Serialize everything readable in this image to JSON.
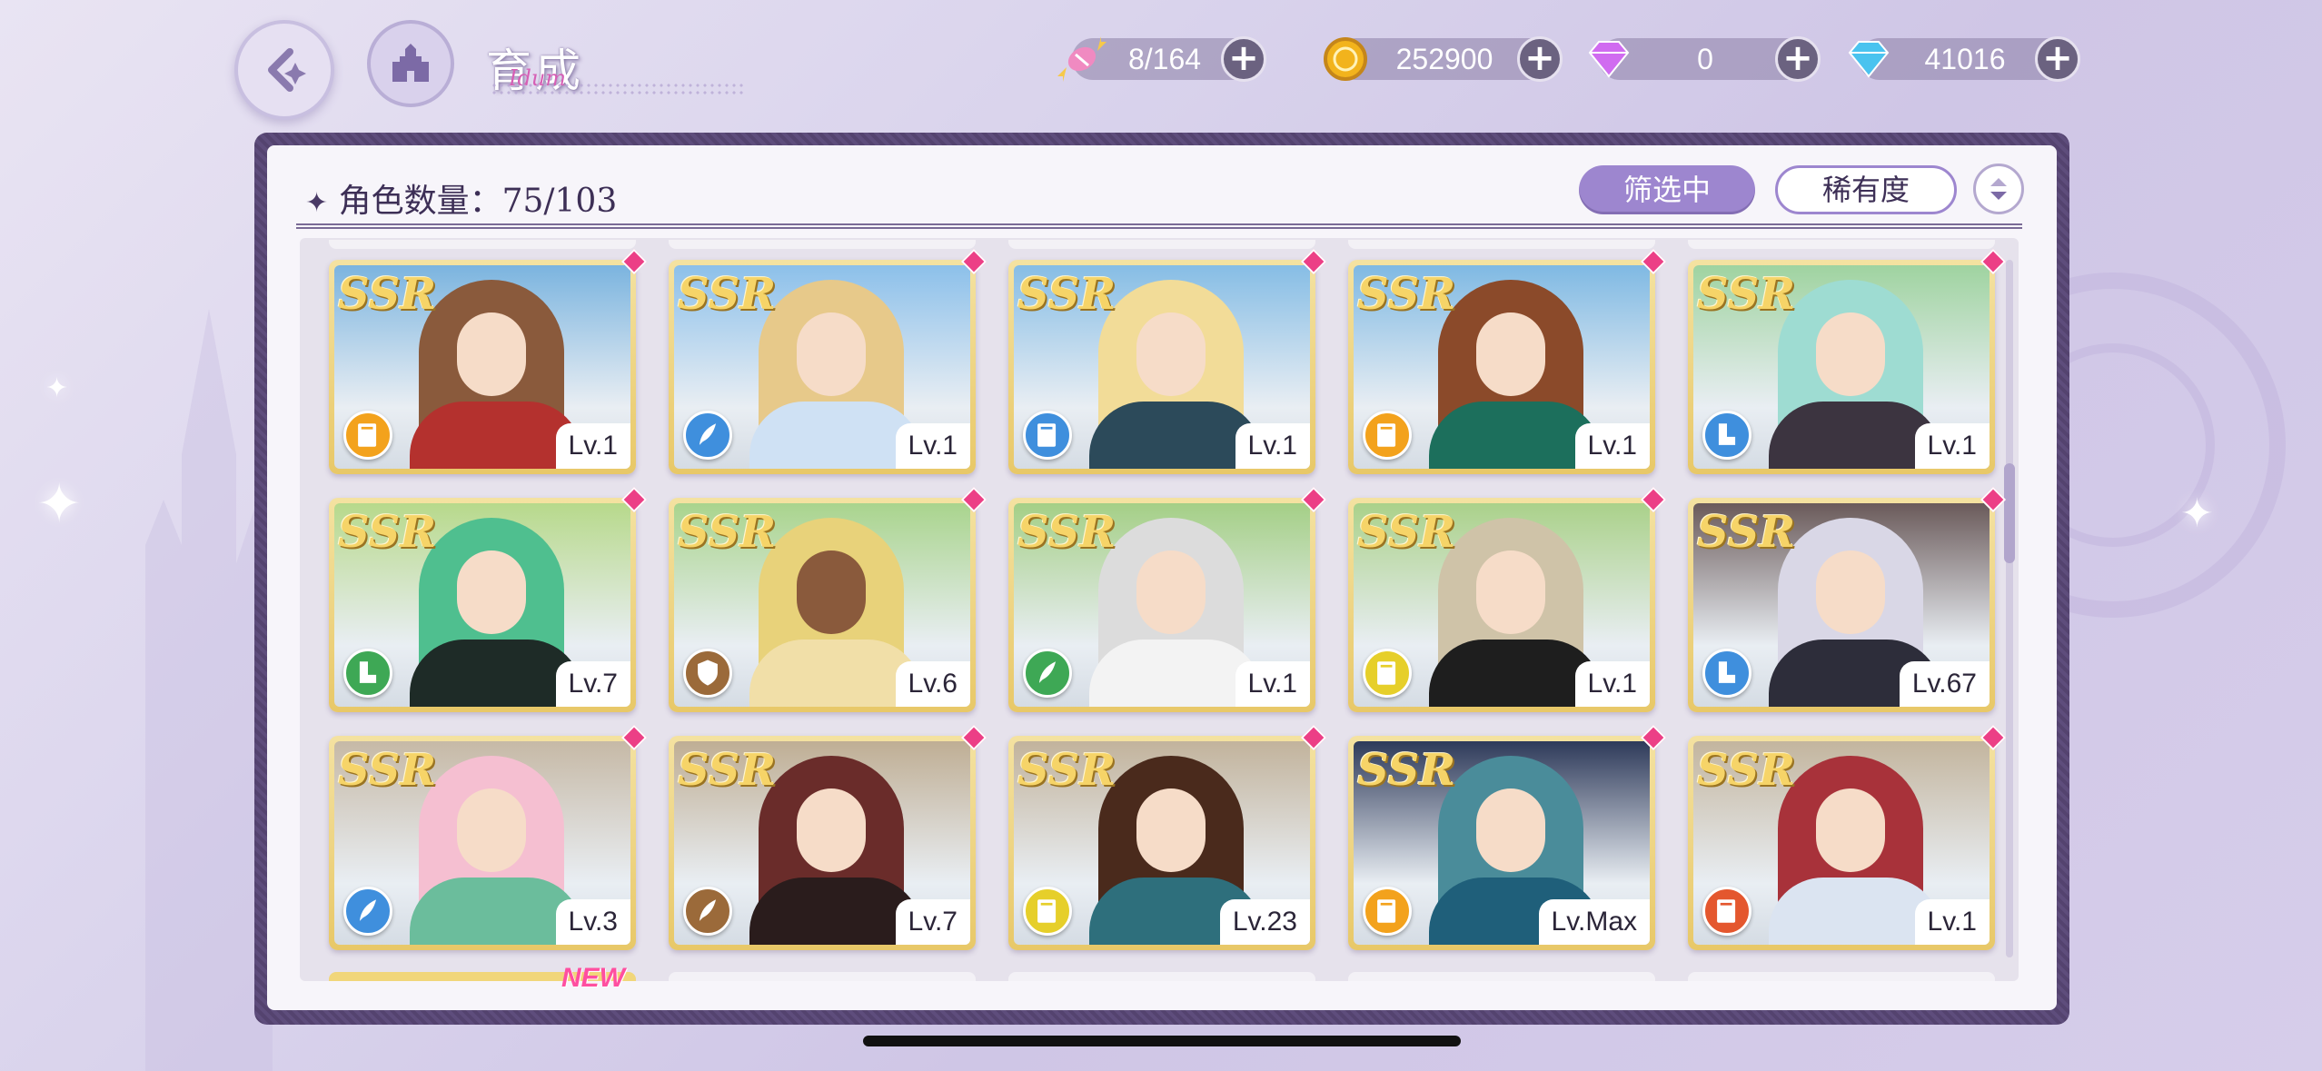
{
  "header": {
    "title": "育成",
    "title_script": "Idum"
  },
  "currencies": [
    {
      "name": "candy",
      "value": "8/164",
      "color": "#f08ac1"
    },
    {
      "name": "coin",
      "value": "252900",
      "color": "#f2b31c"
    },
    {
      "name": "pink-diamond",
      "value": "0",
      "color": "#d06bf0"
    },
    {
      "name": "blue-diamond",
      "value": "41016",
      "color": "#4ac3ef"
    }
  ],
  "panel": {
    "count_label": "角色数量：75/103",
    "filter_label": "筛选中",
    "sort_label": "稀有度"
  },
  "rarity_text": "SSR",
  "new_tag": "NEW",
  "cards": [
    {
      "level": "Lv.1",
      "badge_color": "#f3a21c",
      "badge_icon": "book-icon",
      "hair": "#8a5a3c",
      "outfit": "#b4312e",
      "bg": "#7bb4df"
    },
    {
      "level": "Lv.1",
      "badge_color": "#3f8fdd",
      "badge_icon": "quill-icon",
      "hair": "#e7c98a",
      "outfit": "#cfe1f4",
      "bg": "#8cc0ea"
    },
    {
      "level": "Lv.1",
      "badge_color": "#3f8fdd",
      "badge_icon": "book-icon",
      "hair": "#f2dc98",
      "outfit": "#2c4a5a",
      "bg": "#86bde5"
    },
    {
      "level": "Lv.1",
      "badge_color": "#f3a21c",
      "badge_icon": "book-icon",
      "hair": "#8b4a2a",
      "outfit": "#1c6f5c",
      "bg": "#7fb9e3"
    },
    {
      "level": "Lv.1",
      "badge_color": "#3f8fdd",
      "badge_icon": "boot-icon",
      "hair": "#9edcd2",
      "outfit": "#3c3440",
      "bg": "#9fd3a0"
    },
    {
      "level": "Lv.7",
      "badge_color": "#3ea855",
      "badge_icon": "boot-icon",
      "hair": "#4fbf8f",
      "outfit": "#1e2b27",
      "bg": "#b7d98b"
    },
    {
      "level": "Lv.6",
      "badge_color": "#9b6a3a",
      "badge_icon": "shield-icon",
      "hair": "#e8d27a",
      "outfit": "#f1dfa8",
      "bg": "#a9d48d"
    },
    {
      "level": "Lv.1",
      "badge_color": "#3ea855",
      "badge_icon": "quill-icon",
      "hair": "#dcdcdc",
      "outfit": "#f3f3f3",
      "bg": "#a4cf86"
    },
    {
      "level": "Lv.1",
      "badge_color": "#e6cf2a",
      "badge_icon": "book-icon",
      "hair": "#cfc3a8",
      "outfit": "#1e1e1e",
      "bg": "#aad18a"
    },
    {
      "level": "Lv.67",
      "badge_color": "#3f8fdd",
      "badge_icon": "boot-icon",
      "hair": "#d9d7e6",
      "outfit": "#2d2d3a",
      "bg": "#6a5a5a"
    },
    {
      "level": "Lv.3",
      "badge_color": "#3f8fdd",
      "badge_icon": "quill-icon",
      "hair": "#f5bfd1",
      "outfit": "#6bbd9c",
      "bg": "#c6b9a6"
    },
    {
      "level": "Lv.7",
      "badge_color": "#9b6a3a",
      "badge_icon": "quill-icon",
      "hair": "#6a2c2a",
      "outfit": "#2a1c1c",
      "bg": "#bfae94"
    },
    {
      "level": "Lv.23",
      "badge_color": "#e6cf2a",
      "badge_icon": "book-icon",
      "hair": "#4a2a1c",
      "outfit": "#2e6f7c",
      "bg": "#c2b39c"
    },
    {
      "level": "Lv.Max",
      "badge_color": "#f3a21c",
      "badge_icon": "book-icon",
      "hair": "#4a8c9a",
      "outfit": "#1f5f7a",
      "bg": "#2e3a5a"
    },
    {
      "level": "Lv.1",
      "badge_color": "#e4572e",
      "badge_icon": "book-icon",
      "hair": "#a8323a",
      "outfit": "#dbe4f1",
      "bg": "#c3b59e"
    }
  ]
}
